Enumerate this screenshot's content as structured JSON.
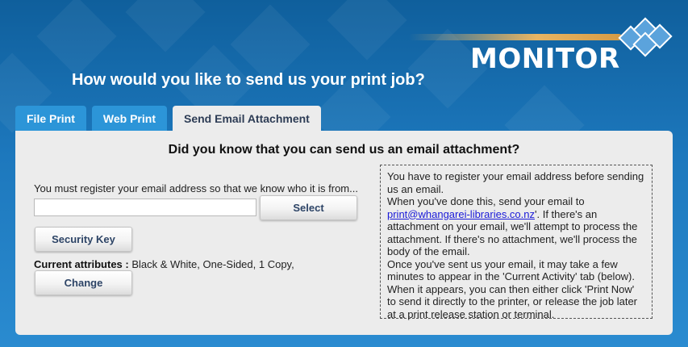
{
  "header": {
    "title": "How would you like to send us your print job?",
    "logo_text": "MONITOR"
  },
  "tabs": [
    {
      "label": "File Print",
      "active": false
    },
    {
      "label": "Web Print",
      "active": false
    },
    {
      "label": "Send Email Attachment",
      "active": true
    }
  ],
  "panel": {
    "heading": "Did you know that you can send us an email attachment?",
    "register_label": "You must register your email address so that we know who it is from...",
    "email_value": "",
    "email_placeholder": "",
    "select_label": "Select",
    "security_key_label": "Security Key",
    "attributes_label": "Current attributes :",
    "attributes_value": "Black & White, One-Sided, 1 Copy,",
    "change_label": "Change"
  },
  "info": {
    "line1": "You have to register your email address before sending us an email.",
    "line2_pre": "When you've done this, send your email to ",
    "email_link": "print@whangarei-libraries.co.nz",
    "line2_post": "'. If there's an attachment on your email, we'll attempt to process the attachment. If there's no attachment, we'll process the body of the email.",
    "line3": "Once you've sent us your email, it may take a few minutes to appear in the 'Current Activity' tab (below). When it appears, you can then either click 'Print Now' to send it directly to the printer, or release the job later at a print release station or terminal."
  },
  "colors": {
    "background": "#1d78bd",
    "tab_inactive": "#2c95d8",
    "panel": "#ececec",
    "logo_accent": "#e8b563",
    "link": "#1a1ad8"
  }
}
